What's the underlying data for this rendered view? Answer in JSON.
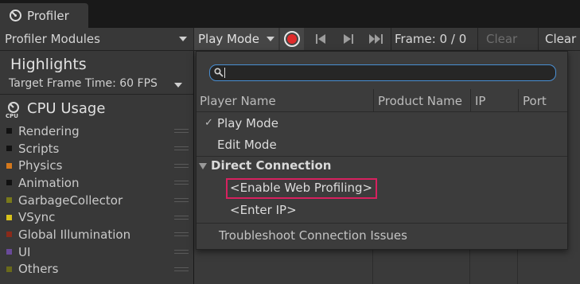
{
  "window": {
    "tab_label": "Profiler",
    "tab_icon": "profiler-gauge-icon"
  },
  "toolbar": {
    "modules_label": "Profiler Modules",
    "play_mode_label": "Play Mode",
    "record_icon": "record-icon",
    "frame_label": "Frame: 0 / 0",
    "clear_label": "Clear",
    "clear_on_play_label": "Clear"
  },
  "highlights": {
    "title": "Highlights",
    "target_frame_time": "Target Frame Time: 60 FPS"
  },
  "cpu": {
    "title": "CPU Usage",
    "icon": "cpu-icon",
    "categories": [
      {
        "label": "Rendering",
        "color": "#111111"
      },
      {
        "label": "Scripts",
        "color": "#111111"
      },
      {
        "label": "Physics",
        "color": "#d4781c"
      },
      {
        "label": "Animation",
        "color": "#111111"
      },
      {
        "label": "GarbageCollector",
        "color": "#7a7a1a"
      },
      {
        "label": "VSync",
        "color": "#d8c21a"
      },
      {
        "label": "Global Illumination",
        "color": "#8a2a1a"
      },
      {
        "label": "UI",
        "color": "#6a4a9a"
      },
      {
        "label": "Others",
        "color": "#6a6a1a"
      }
    ]
  },
  "popup": {
    "search": {
      "value": "",
      "placeholder": ""
    },
    "columns": {
      "player_name": "Player Name",
      "product_name": "Product Name",
      "ip": "IP",
      "port": "Port"
    },
    "options": {
      "play_mode": "Play Mode",
      "edit_mode": "Edit Mode",
      "checkmark": "✓"
    },
    "direct_connection": {
      "title": "Direct Connection",
      "enable_web_profiling": "<Enable Web Profiling>",
      "enter_ip": "<Enter IP>"
    },
    "troubleshoot": "Troubleshoot Connection Issues"
  },
  "colors": {
    "accent_blue": "#4a8fd3",
    "highlight_pink": "#d7215f",
    "record_red": "#e02b2b"
  }
}
